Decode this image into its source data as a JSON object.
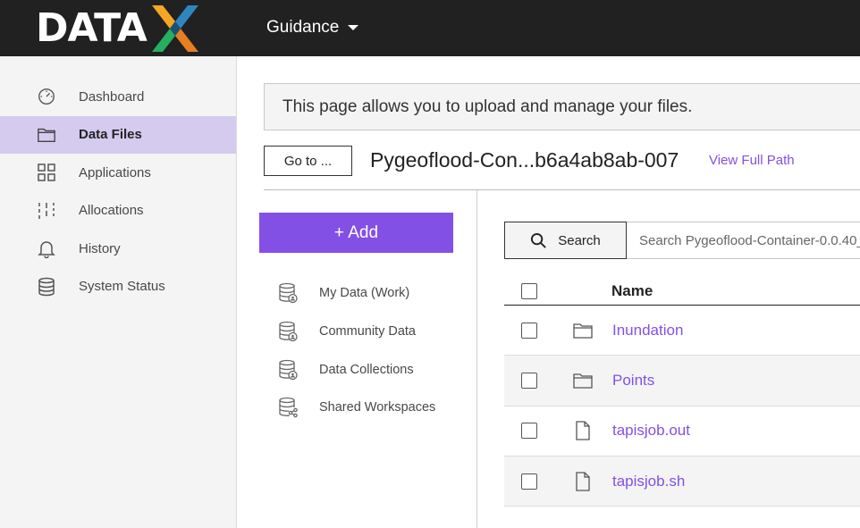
{
  "header": {
    "logo_text": "DATA",
    "guidance_label": "Guidance"
  },
  "sidebar": {
    "items": [
      {
        "label": "Dashboard",
        "icon": "dashboard-icon",
        "active": false
      },
      {
        "label": "Data Files",
        "icon": "folder-icon",
        "active": true
      },
      {
        "label": "Applications",
        "icon": "grid-icon",
        "active": false
      },
      {
        "label": "Allocations",
        "icon": "sliders-icon",
        "active": false
      },
      {
        "label": "History",
        "icon": "bell-icon",
        "active": false
      },
      {
        "label": "System Status",
        "icon": "database-icon",
        "active": false
      }
    ]
  },
  "main": {
    "banner_text": "This page allows you to upload and manage your files.",
    "goto_label": "Go to ...",
    "path_title": "Pygeoflood-Con...b6a4ab8ab-007",
    "view_full_path": "View Full Path",
    "add_label": "+ Add",
    "systems": [
      {
        "label": "My Data (Work)"
      },
      {
        "label": "Community Data"
      },
      {
        "label": "Data Collections"
      },
      {
        "label": "Shared Workspaces"
      }
    ],
    "search": {
      "button_label": "Search",
      "placeholder": "Search Pygeoflood-Container-0.0.40_"
    },
    "table": {
      "header_name": "Name",
      "rows": [
        {
          "name": "Inundation",
          "type": "folder"
        },
        {
          "name": "Points",
          "type": "folder"
        },
        {
          "name": "tapisjob.out",
          "type": "file"
        },
        {
          "name": "tapisjob.sh",
          "type": "file"
        }
      ]
    }
  },
  "colors": {
    "accent": "#8350e6",
    "topbar": "#212121",
    "sidebar_bg": "#f4f4f4",
    "active_nav": "#d4cbef"
  }
}
